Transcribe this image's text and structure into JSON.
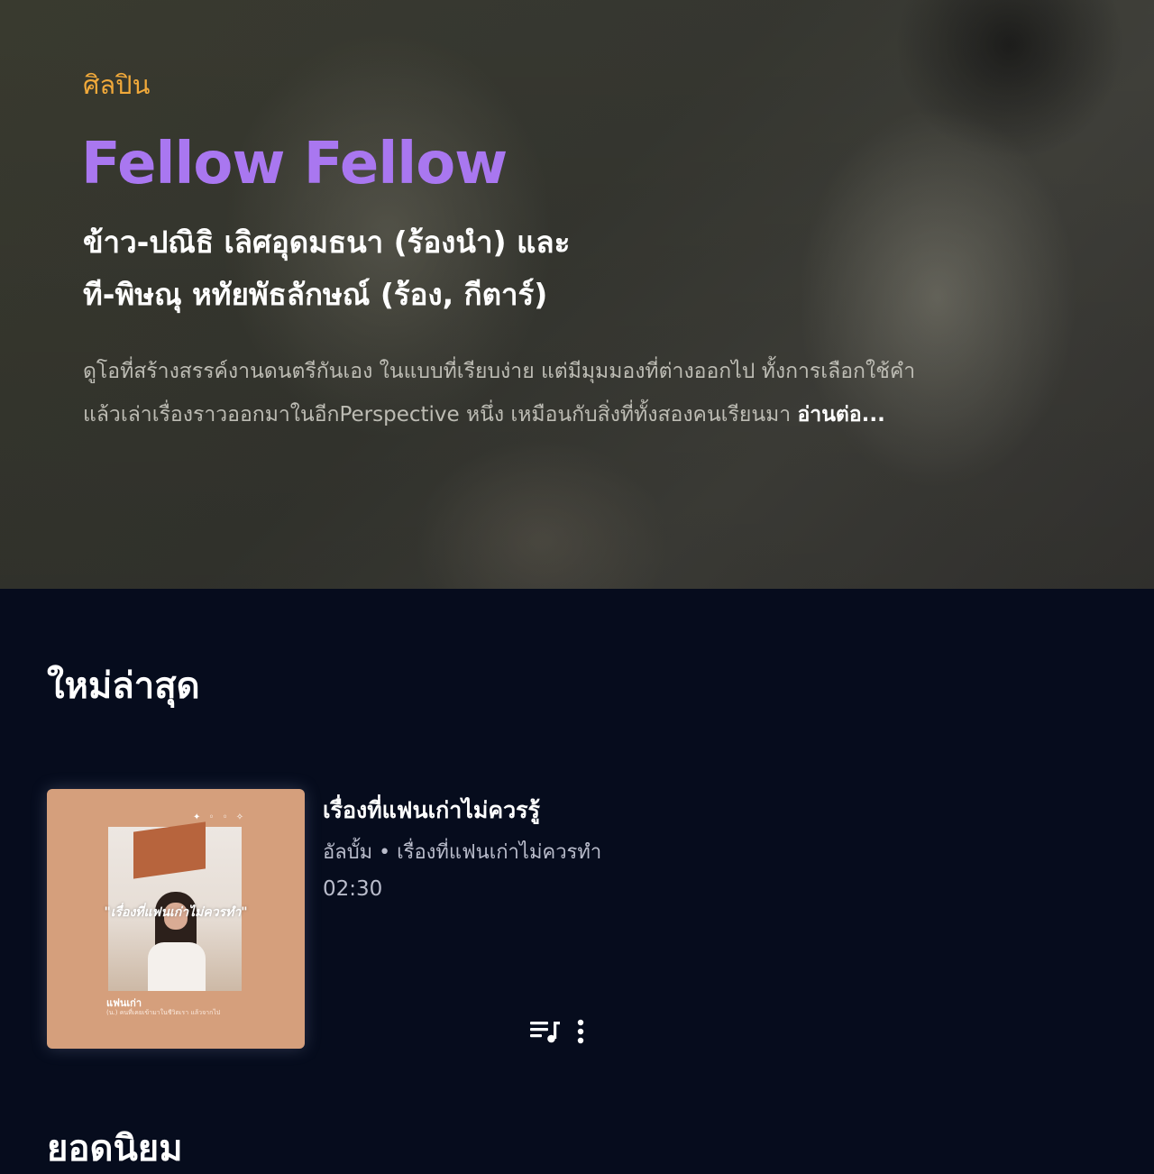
{
  "hero": {
    "eyebrow": "ศิลปิน",
    "artist_name": "Fellow Fellow",
    "members_line1": "ข้าว-ปณิธิ เลิศอุดมธนา (ร้องนำ) และ",
    "members_line2": "ที-พิษณุ หทัยพัธลักษณ์ (ร้อง, กีตาร์)",
    "bio_line1": "ดูโอที่สร้างสรรค์งานดนตรีกันเอง ในแบบที่เรียบง่าย แต่มีมุมมองที่ต่างออกไป ทั้งการเลือกใช้คำ",
    "bio_line2": "แล้วเล่าเรื่องราวออกมาในอีกPerspective หนึ่ง เหมือนกับสิ่งที่ทั้งสองคนเรียนมา ",
    "read_more": "อ่านต่อ..."
  },
  "latest": {
    "section_title": "ใหม่ล่าสุด",
    "item": {
      "title": "เรื่องที่แฟนเก่าไม่ควรรู้",
      "meta": "อัลบั้ม • เรื่องที่แฟนเก่าไม่ควรทำ",
      "duration": "02:30",
      "cover": {
        "quote": "\"เรื่องที่แฟนเก่าไม่ควรทำ\"",
        "track_label": "แฟนเก่า",
        "small_text": "(น.) คนที่เคยเข้ามาในชีวิตเรา แล้วจากไป"
      },
      "queue_icon": "playlist-add-icon",
      "more_icon": "more-vertical-icon"
    }
  },
  "popular": {
    "section_title": "ยอดนิยม"
  },
  "colors": {
    "eyebrow": "#f1a93a",
    "artist_name": "#a977f0",
    "background": "#060c1d"
  }
}
